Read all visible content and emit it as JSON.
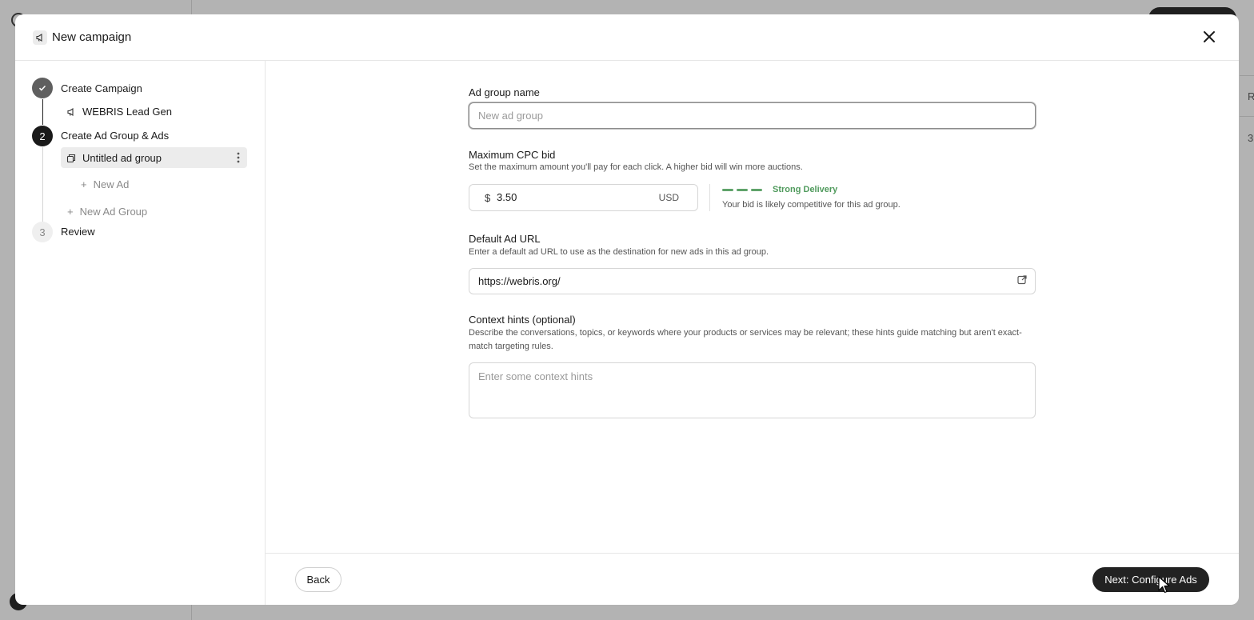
{
  "modal": {
    "title": "New campaign",
    "title_icon": "megaphone-icon",
    "close_icon": "close-icon"
  },
  "steps": [
    {
      "number": "1",
      "label": "Create Campaign",
      "state": "done",
      "icon": "check-icon"
    },
    {
      "number": "2",
      "label": "Create Ad Group & Ads",
      "state": "active"
    },
    {
      "number": "3",
      "label": "Review",
      "state": "pending"
    }
  ],
  "sidebar": {
    "campaign_name": "WEBRIS Lead Gen",
    "campaign_icon": "megaphone-icon",
    "ad_group_name": "Untitled ad group",
    "ad_group_icon": "ad-group-icon",
    "new_ad_label": "New Ad",
    "new_ad_group_label": "New Ad Group"
  },
  "form": {
    "ad_group_name": {
      "label": "Ad group name",
      "placeholder": "New ad group",
      "value": ""
    },
    "cpc_bid": {
      "label": "Maximum CPC bid",
      "help": "Set the maximum amount you'll pay for each click. A higher bid will win more auctions.",
      "currency_symbol": "$",
      "value": "3.50",
      "currency": "USD",
      "delivery_label": "Strong Delivery",
      "delivery_desc": "Your bid is likely competitive for this ad group.",
      "delivery_color": "#4f9a5c",
      "delivery_level": "3/3"
    },
    "default_url": {
      "label": "Default Ad URL",
      "help": "Enter a default ad URL to use as the destination for new ads in this ad group.",
      "value": "https://webris.org/",
      "icon": "external-link-icon"
    },
    "context_hints": {
      "label": "Context hints (optional)",
      "help": "Describe the conversations, topics, or keywords where your products or services may be relevant; these hints guide matching but aren't exact-match targeting rules.",
      "placeholder": "Enter some context hints"
    }
  },
  "footer": {
    "back_label": "Back",
    "next_label": "Next: Configure Ads"
  },
  "background": {
    "right_header_text": "R",
    "right_cell_text": "3"
  }
}
